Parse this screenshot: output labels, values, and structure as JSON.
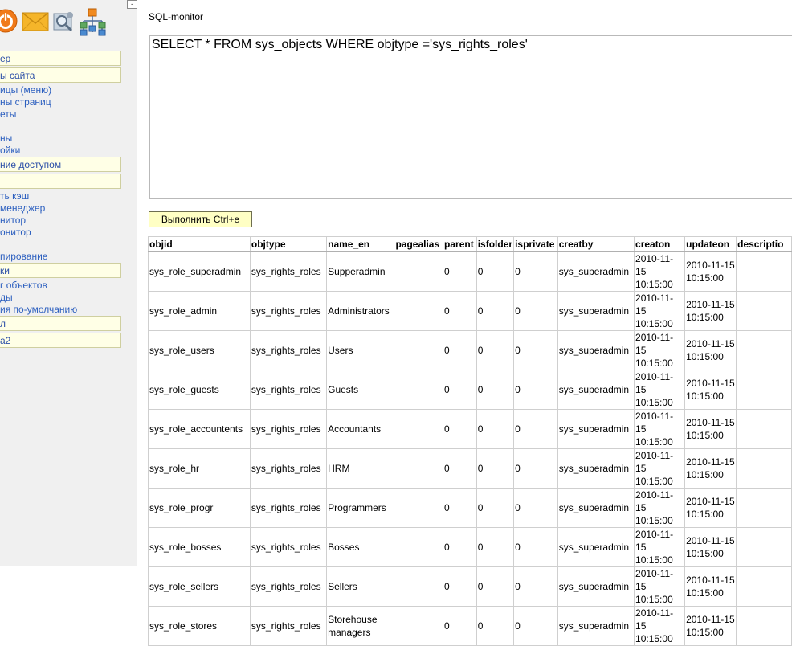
{
  "sidebar": {
    "collapse_label": "-",
    "nav": [
      {
        "type": "section",
        "label": "ер"
      },
      {
        "type": "section",
        "label": "ы сайта"
      },
      {
        "type": "link",
        "label": "ицы (меню)"
      },
      {
        "type": "link",
        "label": "ны страниц"
      },
      {
        "type": "link",
        "label": "еты"
      },
      {
        "type": "link",
        "label": ""
      },
      {
        "type": "link",
        "label": "ны"
      },
      {
        "type": "link",
        "label": "ойки"
      },
      {
        "type": "section",
        "label": "ние доступом"
      },
      {
        "type": "section",
        "label": ""
      },
      {
        "type": "link",
        "label": "ть кэш"
      },
      {
        "type": "link",
        "label": "менеджер"
      },
      {
        "type": "link",
        "label": "нитор"
      },
      {
        "type": "link",
        "label": "онитор"
      },
      {
        "type": "link",
        "label": ""
      },
      {
        "type": "link",
        "label": "пирование"
      },
      {
        "type": "section",
        "label": "ки"
      },
      {
        "type": "link",
        "label": "г объектов"
      },
      {
        "type": "link",
        "label": "ды"
      },
      {
        "type": "link",
        "label": "ия по-умолчанию"
      },
      {
        "type": "section",
        "label": "л"
      },
      {
        "type": "section",
        "label": "а2"
      }
    ]
  },
  "main": {
    "title": "SQL-monitor",
    "query": "SELECT * FROM sys_objects WHERE objtype ='sys_rights_roles'",
    "run_button": "Выполнить Ctrl+e"
  },
  "table": {
    "columns": [
      "objid",
      "objtype",
      "name_en",
      "pagealias",
      "parent",
      "isfolder",
      "isprivate",
      "creatby",
      "creaton",
      "updateon",
      "descriptio"
    ],
    "rows": [
      [
        "sys_role_superadmin",
        "sys_rights_roles",
        "Supperadmin",
        "",
        "0",
        "0",
        "0",
        "sys_superadmin",
        "2010-11-15 10:15:00",
        "2010-11-15 10:15:00",
        ""
      ],
      [
        "sys_role_admin",
        "sys_rights_roles",
        "Administrators",
        "",
        "0",
        "0",
        "0",
        "sys_superadmin",
        "2010-11-15 10:15:00",
        "2010-11-15 10:15:00",
        ""
      ],
      [
        "sys_role_users",
        "sys_rights_roles",
        "Users",
        "",
        "0",
        "0",
        "0",
        "sys_superadmin",
        "2010-11-15 10:15:00",
        "2010-11-15 10:15:00",
        ""
      ],
      [
        "sys_role_guests",
        "sys_rights_roles",
        "Guests",
        "",
        "0",
        "0",
        "0",
        "sys_superadmin",
        "2010-11-15 10:15:00",
        "2010-11-15 10:15:00",
        ""
      ],
      [
        "sys_role_accountents",
        "sys_rights_roles",
        "Accountants",
        "",
        "0",
        "0",
        "0",
        "sys_superadmin",
        "2010-11-15 10:15:00",
        "2010-11-15 10:15:00",
        ""
      ],
      [
        "sys_role_hr",
        "sys_rights_roles",
        "HRM",
        "",
        "0",
        "0",
        "0",
        "sys_superadmin",
        "2010-11-15 10:15:00",
        "2010-11-15 10:15:00",
        ""
      ],
      [
        "sys_role_progr",
        "sys_rights_roles",
        "Programmers",
        "",
        "0",
        "0",
        "0",
        "sys_superadmin",
        "2010-11-15 10:15:00",
        "2010-11-15 10:15:00",
        ""
      ],
      [
        "sys_role_bosses",
        "sys_rights_roles",
        "Bosses",
        "",
        "0",
        "0",
        "0",
        "sys_superadmin",
        "2010-11-15 10:15:00",
        "2010-11-15 10:15:00",
        ""
      ],
      [
        "sys_role_sellers",
        "sys_rights_roles",
        "Sellers",
        "",
        "0",
        "0",
        "0",
        "sys_superadmin",
        "2010-11-15 10:15:00",
        "2010-11-15 10:15:00",
        ""
      ],
      [
        "sys_role_stores",
        "sys_rights_roles",
        "Storehouse managers",
        "",
        "0",
        "0",
        "0",
        "sys_superadmin",
        "2010-11-15 10:15:00",
        "2010-11-15 10:15:00",
        ""
      ]
    ]
  },
  "icons": [
    "power-icon",
    "mail-icon",
    "search-settings-icon",
    "sitemap-icon"
  ],
  "colors": {
    "sidebar_bg": "#f0f0f0",
    "section_bg": "#ffffe6",
    "link": "#2c5fbf",
    "button_bg": "#ffffc4"
  }
}
